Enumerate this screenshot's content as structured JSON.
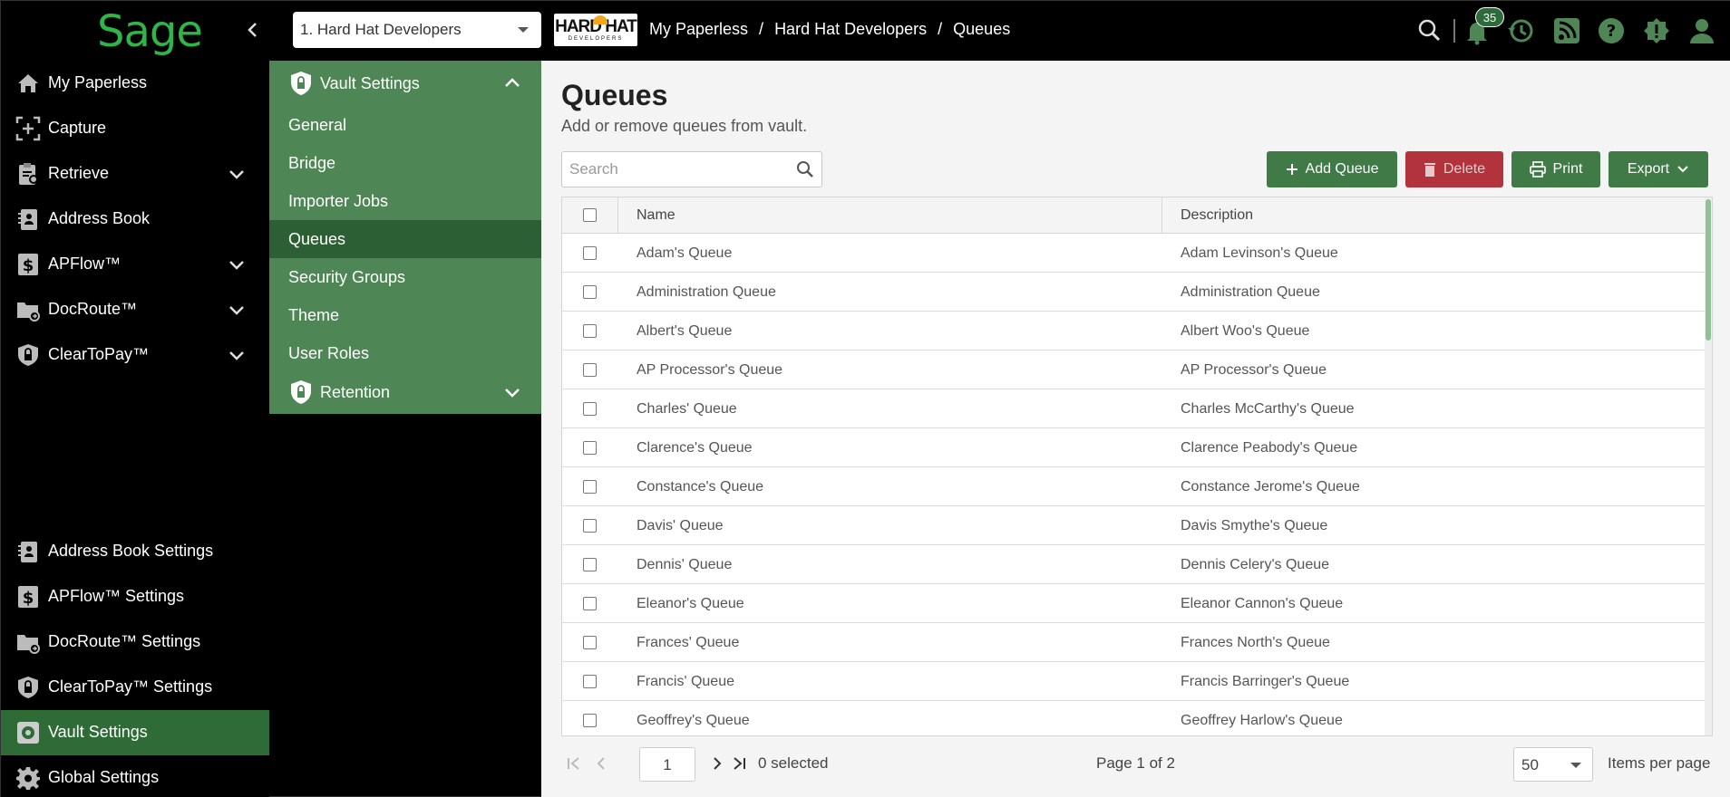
{
  "header": {
    "logo": "Sage",
    "vault_select": "1. Hard Hat Developers",
    "company_logo_main": "HARD HAT",
    "company_logo_sub": "DEVELOPERS",
    "breadcrumb": [
      "My Paperless",
      "Hard Hat Developers",
      "Queues"
    ],
    "notification_count": "35"
  },
  "leftnav": {
    "items": [
      {
        "label": "My Paperless"
      },
      {
        "label": "Capture"
      },
      {
        "label": "Retrieve"
      },
      {
        "label": "Address Book"
      },
      {
        "label": "APFlow™"
      },
      {
        "label": "DocRoute™"
      },
      {
        "label": "ClearToPay™"
      }
    ],
    "settings": [
      {
        "label": "Address Book Settings"
      },
      {
        "label": "APFlow™ Settings"
      },
      {
        "label": "DocRoute™ Settings"
      },
      {
        "label": "ClearToPay™ Settings"
      },
      {
        "label": "Vault Settings"
      },
      {
        "label": "Global Settings"
      }
    ]
  },
  "subnav": {
    "header": "Vault Settings",
    "items": [
      "General",
      "Bridge",
      "Importer Jobs",
      "Queues",
      "Security Groups",
      "Theme",
      "User Roles"
    ],
    "footer": "Retention"
  },
  "main": {
    "title": "Queues",
    "subtitle": "Add or remove queues from vault.",
    "search_placeholder": "Search",
    "buttons": {
      "add": "Add Queue",
      "delete": "Delete",
      "print": "Print",
      "export": "Export"
    },
    "columns": [
      "Name",
      "Description"
    ],
    "rows": [
      {
        "name": "Adam's Queue",
        "desc": "Adam Levinson's Queue"
      },
      {
        "name": "Administration Queue",
        "desc": "Administration Queue"
      },
      {
        "name": "Albert's Queue",
        "desc": "Albert Woo's Queue"
      },
      {
        "name": "AP Processor's Queue",
        "desc": "AP Processor's Queue"
      },
      {
        "name": "Charles' Queue",
        "desc": "Charles McCarthy's Queue"
      },
      {
        "name": "Clarence's Queue",
        "desc": "Clarence Peabody's Queue"
      },
      {
        "name": "Constance's Queue",
        "desc": "Constance Jerome's Queue"
      },
      {
        "name": "Davis' Queue",
        "desc": "Davis Smythe's Queue"
      },
      {
        "name": "Dennis' Queue",
        "desc": "Dennis Celery's Queue"
      },
      {
        "name": "Eleanor's Queue",
        "desc": "Eleanor Cannon's Queue"
      },
      {
        "name": "Frances' Queue",
        "desc": "Frances North's Queue"
      },
      {
        "name": "Francis' Queue",
        "desc": "Francis Barringer's Queue"
      },
      {
        "name": "Geoffrey's Queue",
        "desc": "Geoffrey Harlow's Queue"
      }
    ],
    "pager": {
      "page_input": "1",
      "selected": "0 selected",
      "page_info": "Page 1 of 2",
      "page_size": "50",
      "per_page_label": "Items per page"
    }
  },
  "colors": {
    "brand_green": "#2fb548",
    "nav_active": "#2f6b36",
    "subnav_bg": "#4f8656",
    "button_green": "#3f7a47",
    "button_red": "#b3333c"
  }
}
